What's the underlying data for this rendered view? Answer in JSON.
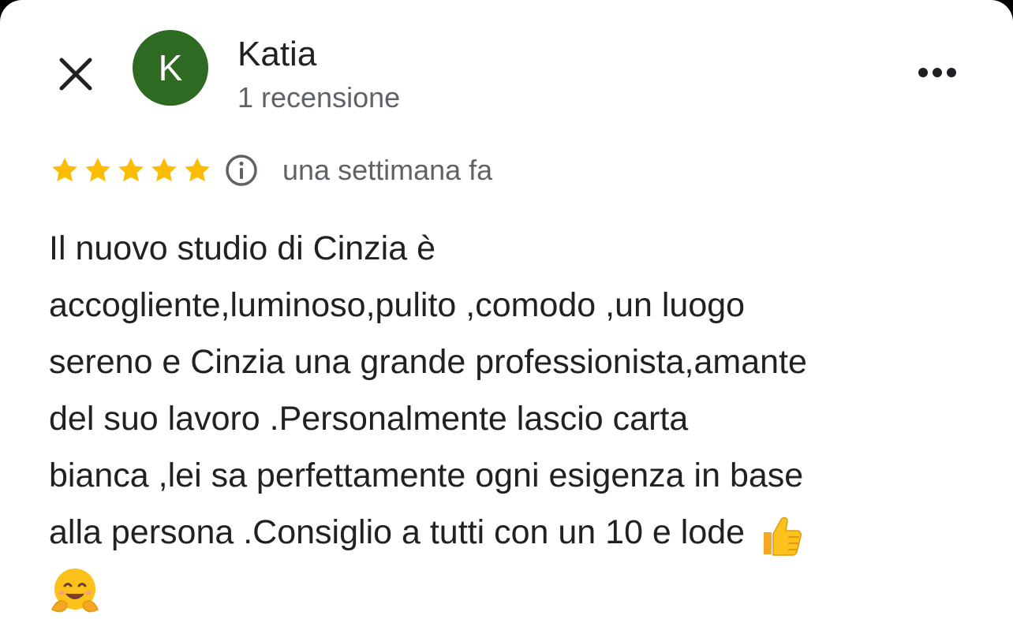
{
  "reviewer": {
    "initial": "K",
    "name": "Katia",
    "review_count": "1 recensione",
    "avatar_color": "#2f6a22"
  },
  "rating": {
    "stars": 5,
    "max_stars": 5,
    "star_color": "#fbbc04",
    "date": "una settimana fa"
  },
  "review": {
    "lines": [
      "Il nuovo studio di Cinzia è",
      "accogliente,luminoso,pulito ,comodo ,un luogo",
      "sereno e Cinzia una grande professionista,amante",
      "del suo lavoro .Personalmente lascio carta",
      "bianca ,lei sa perfettamente ogni esigenza in base",
      "alla persona .Consiglio a tutti con un 10 e lode"
    ],
    "emojis": [
      "thumbs-up",
      "hugging-face"
    ]
  },
  "icons": {
    "close": "close-icon",
    "more": "more-horizontal-icon",
    "info": "info-icon",
    "star": "star-icon"
  }
}
